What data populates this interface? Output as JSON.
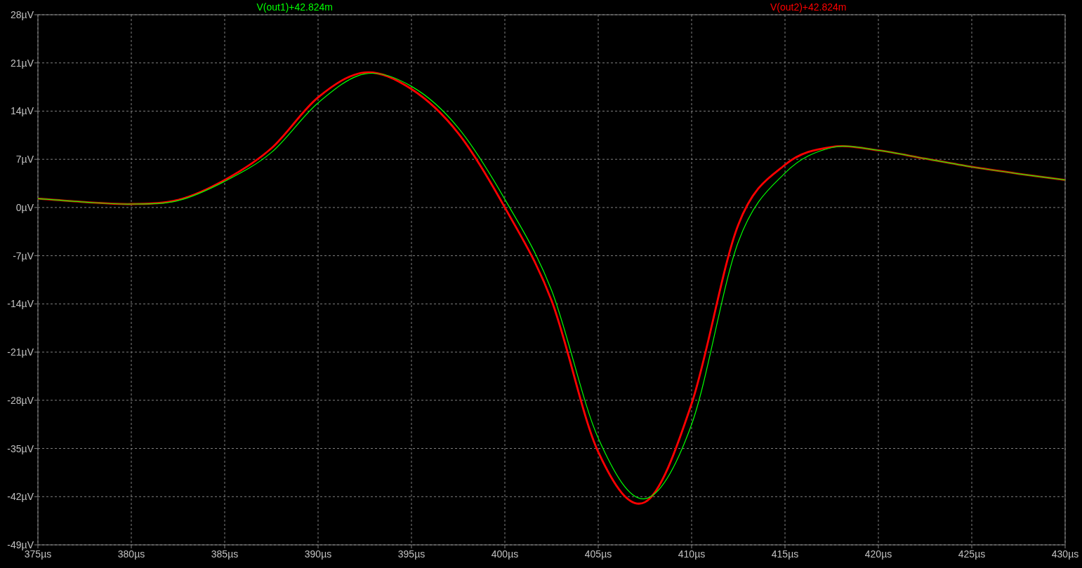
{
  "waveform_plot": {
    "chart_data": {
      "type": "line",
      "x": [
        375,
        377.5,
        380,
        382.5,
        385,
        387.5,
        390,
        392.5,
        395,
        397.5,
        400,
        402.5,
        405,
        407.5,
        410,
        412.5,
        415,
        417.5,
        420,
        422.5,
        425,
        427.5,
        430
      ],
      "series": [
        {
          "name": "V(out1)+42.824m",
          "color": "#00ff00",
          "values": [
            1.3,
            0.8,
            0.5,
            1.0,
            3.8,
            8.0,
            15.2,
            19.4,
            17.6,
            11.6,
            1.2,
            -12.0,
            -33.5,
            -42.3,
            -31.5,
            -5.0,
            5.0,
            8.7,
            8.3,
            7.1,
            5.9,
            4.9,
            4.0
          ]
        },
        {
          "name": "V(out2)+42.824m",
          "color": "#ff0000",
          "values": [
            1.3,
            0.8,
            0.5,
            1.1,
            4.0,
            8.6,
            16.0,
            19.6,
            17.2,
            10.8,
            0.0,
            -13.5,
            -35.5,
            -42.8,
            -28.5,
            -2.5,
            6.2,
            8.8,
            8.3,
            7.1,
            5.9,
            4.9,
            4.0
          ]
        }
      ],
      "grid": true,
      "xlim": [
        375,
        430
      ],
      "ylim": [
        -49,
        28
      ],
      "xticks": [
        {
          "value": 375,
          "label": "375µs"
        },
        {
          "value": 380,
          "label": "380µs"
        },
        {
          "value": 385,
          "label": "385µs"
        },
        {
          "value": 390,
          "label": "390µs"
        },
        {
          "value": 395,
          "label": "395µs"
        },
        {
          "value": 400,
          "label": "400µs"
        },
        {
          "value": 405,
          "label": "405µs"
        },
        {
          "value": 410,
          "label": "410µs"
        },
        {
          "value": 415,
          "label": "415µs"
        },
        {
          "value": 420,
          "label": "420µs"
        },
        {
          "value": 425,
          "label": "425µs"
        },
        {
          "value": 430,
          "label": "430µs"
        }
      ],
      "yticks": [
        {
          "value": 28,
          "label": "28µV"
        },
        {
          "value": 21,
          "label": "21µV"
        },
        {
          "value": 14,
          "label": "14µV"
        },
        {
          "value": 7,
          "label": "7µV"
        },
        {
          "value": 0,
          "label": "0µV"
        },
        {
          "value": -7,
          "label": "-7µV"
        },
        {
          "value": -14,
          "label": "-14µV"
        },
        {
          "value": -21,
          "label": "-21µV"
        },
        {
          "value": -28,
          "label": "-28µV"
        },
        {
          "value": -35,
          "label": "-35µV"
        },
        {
          "value": -42,
          "label": "-42µV"
        },
        {
          "value": -49,
          "label": "-49µV"
        }
      ]
    }
  }
}
